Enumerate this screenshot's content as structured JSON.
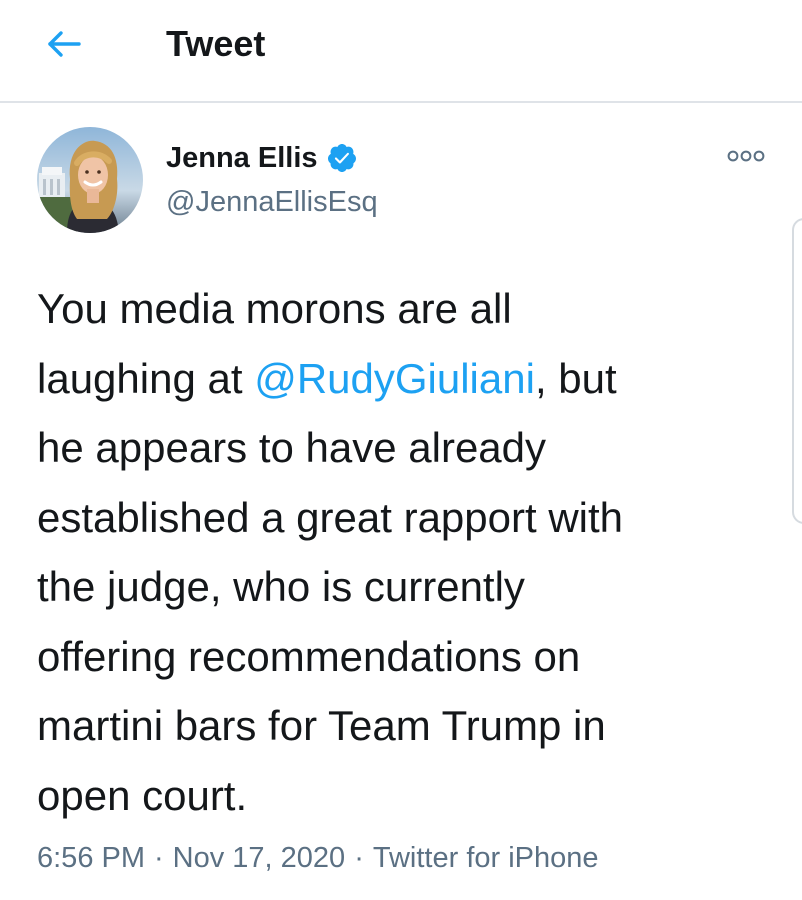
{
  "header": {
    "title": "Tweet",
    "back_icon": "arrow-left-icon",
    "accent_color": "#1da1f2"
  },
  "author": {
    "name": "Jenna Ellis",
    "handle": "@JennaEllisEsq",
    "verified": true,
    "verified_icon": "verified-badge-icon",
    "avatar_icon": "avatar-photo"
  },
  "more_icon": "more-options-icon",
  "tweet": {
    "text_before": "You media morons are all\nlaughing at ",
    "mention": "@RudyGiuliani",
    "text_after": ", but\nhe appears to have already\nestablished a great rapport with\nthe judge, who is currently\noffering recommendations on\nmartini bars for Team Trump in\nopen court."
  },
  "meta": {
    "time": "6:56 PM",
    "separator": "·",
    "date": "Nov 17, 2020",
    "source": "Twitter for iPhone"
  },
  "colors": {
    "text": "#14171a",
    "secondary": "#5b7083",
    "link": "#1da1f2",
    "divider": "#dfe3e8"
  }
}
